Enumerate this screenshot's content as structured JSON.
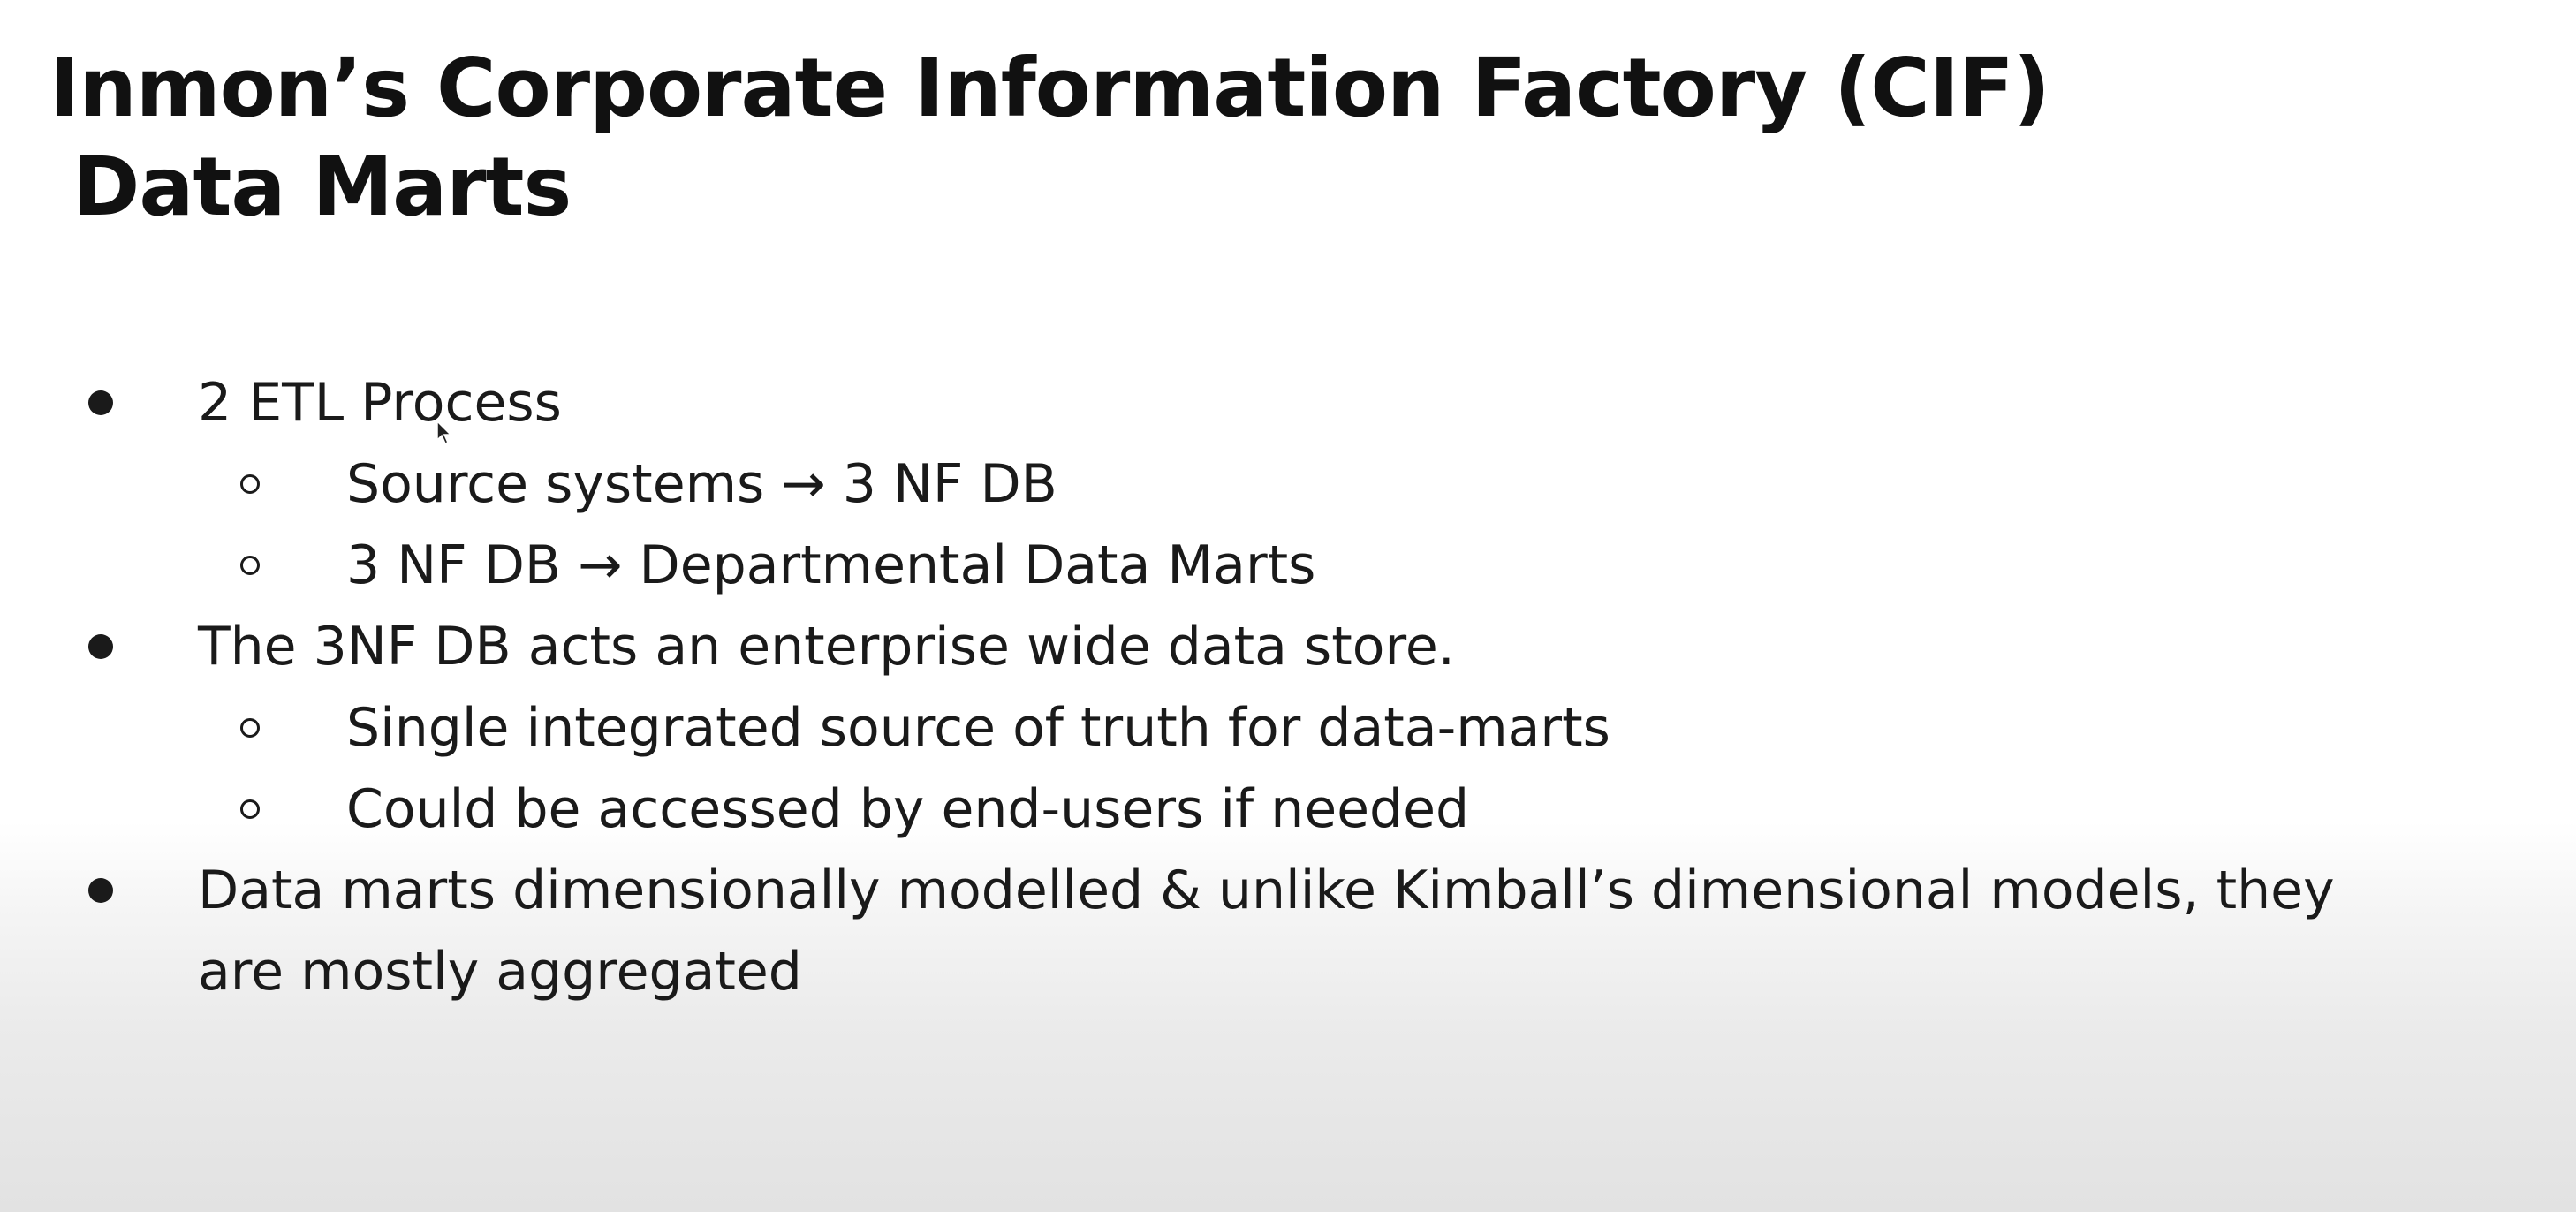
{
  "slide": {
    "title_line1": "Inmon’s Corporate Information Factory (CIF)",
    "title_line2": "Data Marts",
    "bullets": [
      {
        "text": "2 ETL Process",
        "sub": [
          "Source systems → 3 NF DB",
          "3 NF DB → Departmental Data Marts"
        ]
      },
      {
        "text": "The 3NF DB acts an enterprise wide data store.",
        "sub": [
          "Single integrated source of truth for data-marts",
          "Could be accessed by end-users if needed"
        ]
      },
      {
        "text": "Data marts dimensionally modelled & unlike Kimball’s dimensional models, they are mostly aggregated",
        "sub": []
      }
    ]
  }
}
